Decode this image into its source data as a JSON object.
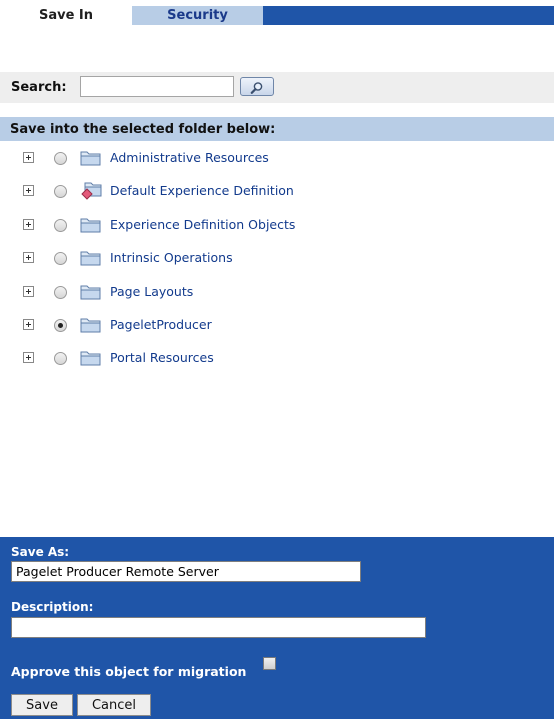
{
  "tabs": [
    {
      "label": "Save In",
      "active": true
    },
    {
      "label": "Security",
      "active": false
    }
  ],
  "search": {
    "label": "Search:",
    "value": "",
    "button_icon": "magnifier-icon"
  },
  "tree": {
    "heading": "Save into the selected folder below:",
    "items": [
      {
        "label": "Administrative Resources",
        "icon": "folder-icon",
        "selected": false
      },
      {
        "label": "Default Experience Definition",
        "icon": "experience-definition-icon",
        "selected": false
      },
      {
        "label": "Experience Definition Objects",
        "icon": "folder-icon",
        "selected": false
      },
      {
        "label": "Intrinsic Operations",
        "icon": "folder-icon",
        "selected": false
      },
      {
        "label": "Page Layouts",
        "icon": "folder-icon",
        "selected": false
      },
      {
        "label": "PageletProducer",
        "icon": "folder-icon",
        "selected": true
      },
      {
        "label": "Portal Resources",
        "icon": "folder-icon",
        "selected": false
      }
    ]
  },
  "save_panel": {
    "save_as_label": "Save As:",
    "save_as_value": "Pagelet Producer Remote Server",
    "description_label": "Description:",
    "description_value": "",
    "approve_label": "Approve this object for migration",
    "approve_checked": false,
    "save_button": "Save",
    "cancel_button": "Cancel"
  },
  "colors": {
    "accent": "#1f55a8",
    "tab_inactive": "#b8cde6",
    "link": "#123a8c"
  }
}
